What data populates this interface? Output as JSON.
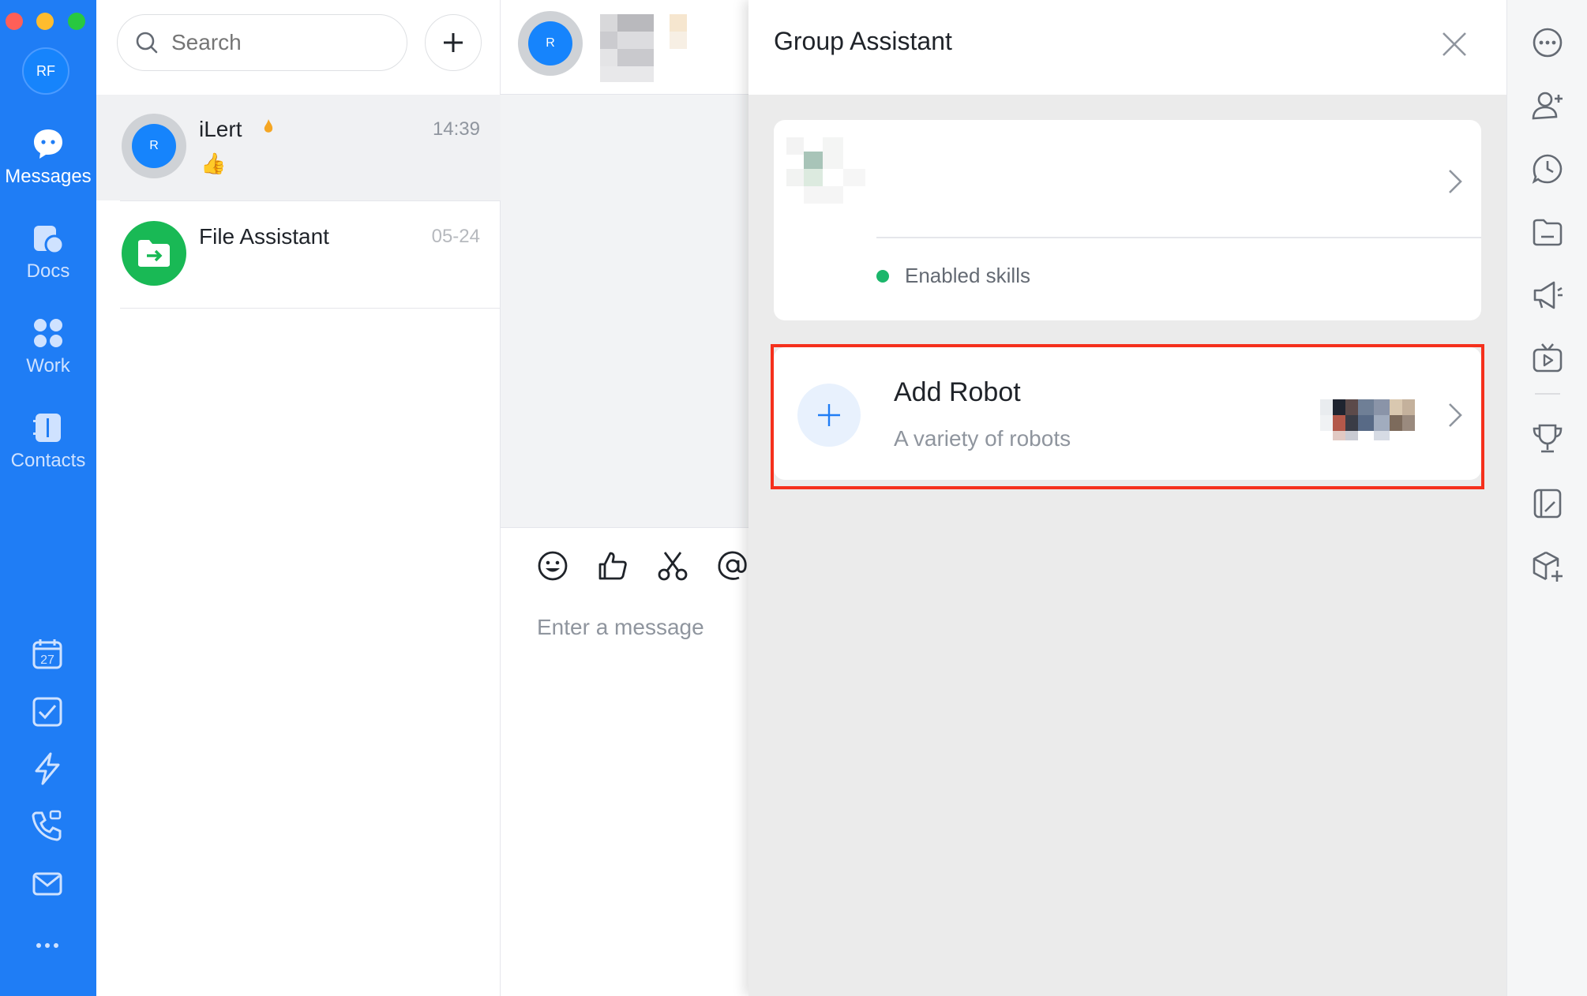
{
  "nav": {
    "avatar_initials": "RF",
    "items": [
      {
        "label": "Messages",
        "icon": "message-bubble-icon",
        "active": true
      },
      {
        "label": "Docs",
        "icon": "docs-icon",
        "active": false
      },
      {
        "label": "Work",
        "icon": "workplace-grid-icon",
        "active": false
      },
      {
        "label": "Contacts",
        "icon": "contacts-book-icon",
        "active": false
      }
    ],
    "bottom_icons": [
      "calendar-icon",
      "tasks-icon",
      "lightning-icon",
      "call-icon",
      "mail-icon",
      "more-dots-icon"
    ],
    "calendar_day": "27"
  },
  "conversations": {
    "search_placeholder": "Search",
    "add_icon": "plus-icon",
    "items": [
      {
        "name": "iLert",
        "avatar_initial": "R",
        "time": "14:39",
        "preview": "👍",
        "selected": true
      },
      {
        "name": "File Assistant",
        "avatar_icon": "folder-arrow-icon",
        "time": "05-24",
        "preview": "",
        "selected": false
      }
    ]
  },
  "chat": {
    "avatar_initial": "R",
    "composer_placeholder": "Enter a message",
    "toolbar_icons": [
      "emoji-icon",
      "thumbs-up-icon",
      "scissors-icon",
      "at-mention-icon"
    ]
  },
  "panel": {
    "title": "Group Assistant",
    "skills_label": "Enabled skills",
    "add_robot_title": "Add Robot",
    "add_robot_subtitle": "A variety of robots"
  },
  "right_toolbar": {
    "icons": [
      "more-icon",
      "add-member-icon",
      "history-icon",
      "folder-icon",
      "announcement-icon",
      "live-video-icon",
      "trophy-icon",
      "notes-icon",
      "add-app-icon"
    ]
  },
  "colors": {
    "nav_blue": "#1f7df5",
    "accent_blue": "#1684fc",
    "highlight_red": "#f5301c",
    "online_green": "#1bb66b",
    "file_assistant_green": "#19b955"
  }
}
